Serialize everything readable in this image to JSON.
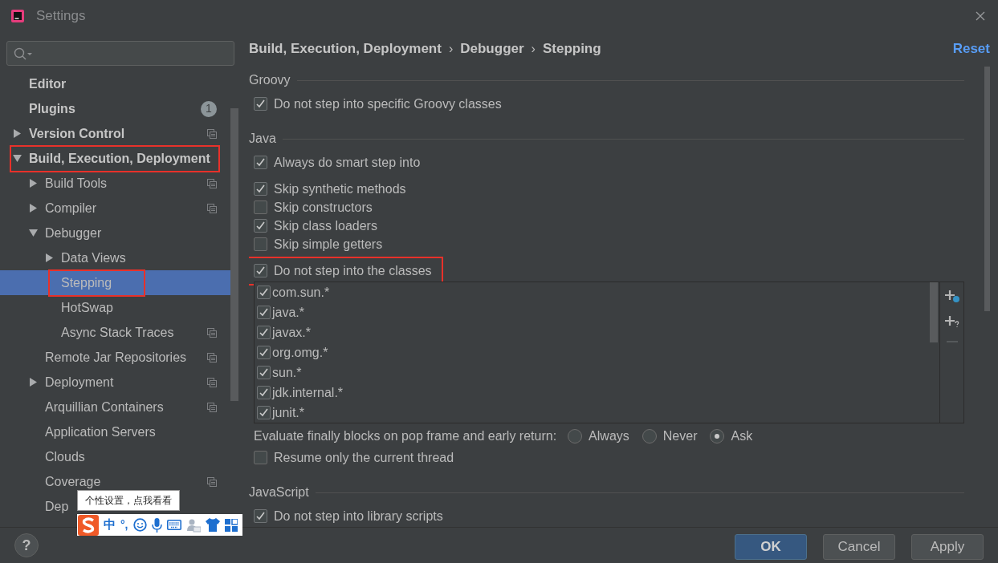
{
  "window": {
    "title": "Settings"
  },
  "sidebar": {
    "items": [
      {
        "label": "Editor",
        "selected": false
      },
      {
        "label": "Plugins",
        "selected": false,
        "badge": "1"
      },
      {
        "label": "Version Control",
        "selected": false,
        "expanded": false,
        "scoped": true
      },
      {
        "label": "Build, Execution, Deployment",
        "selected": false,
        "expanded": true,
        "highlighted": true,
        "children": [
          {
            "label": "Build Tools",
            "selected": false,
            "expanded": false,
            "scoped": true
          },
          {
            "label": "Compiler",
            "selected": false,
            "expanded": false,
            "scoped": true
          },
          {
            "label": "Debugger",
            "selected": false,
            "expanded": true,
            "children": [
              {
                "label": "Data Views",
                "selected": false,
                "expanded": false
              },
              {
                "label": "Stepping",
                "selected": true,
                "highlighted": true
              },
              {
                "label": "HotSwap",
                "selected": false
              },
              {
                "label": "Async Stack Traces",
                "selected": false,
                "scoped": true
              }
            ]
          },
          {
            "label": "Remote Jar Repositories",
            "selected": false,
            "scoped": true
          },
          {
            "label": "Deployment",
            "selected": false,
            "expanded": false,
            "scoped": true
          },
          {
            "label": "Arquillian Containers",
            "selected": false,
            "scoped": true
          },
          {
            "label": "Application Servers",
            "selected": false
          },
          {
            "label": "Clouds",
            "selected": false
          },
          {
            "label": "Coverage",
            "selected": false,
            "scoped": true
          },
          {
            "label": "Dep",
            "selected": false
          }
        ]
      }
    ]
  },
  "breadcrumb": {
    "parts": [
      "Build, Execution, Deployment",
      "Debugger",
      "Stepping"
    ],
    "separator": "›"
  },
  "reset": "Reset",
  "sections": [
    {
      "title": "Groovy",
      "items": [
        {
          "kind": "checkbox",
          "label": "Do not step into specific Groovy classes",
          "checked": true
        }
      ]
    },
    {
      "title": "Java",
      "items": [
        {
          "kind": "checkbox",
          "label": "Always do smart step into",
          "checked": true
        },
        {
          "kind": "checkbox",
          "label": "Skip synthetic methods",
          "checked": true
        },
        {
          "kind": "checkbox",
          "label": "Skip constructors",
          "checked": false
        },
        {
          "kind": "checkbox",
          "label": "Skip class loaders",
          "checked": true
        },
        {
          "kind": "checkbox",
          "label": "Skip simple getters",
          "checked": false
        },
        {
          "kind": "checkbox",
          "label": "Do not step into the classes",
          "checked": true,
          "highlighted": true
        },
        {
          "kind": "class_list",
          "rows": [
            {
              "label": "com.sun.*",
              "checked": true
            },
            {
              "label": "java.*",
              "checked": true
            },
            {
              "label": "javax.*",
              "checked": true
            },
            {
              "label": "org.omg.*",
              "checked": true
            },
            {
              "label": "sun.*",
              "checked": true
            },
            {
              "label": "jdk.internal.*",
              "checked": true
            },
            {
              "label": "junit.*",
              "checked": true
            }
          ],
          "remove_disabled": true
        },
        {
          "kind": "radio_group",
          "label": "Evaluate finally blocks on pop frame and early return:",
          "options": [
            {
              "label": "Always",
              "selected": false
            },
            {
              "label": "Never",
              "selected": false
            },
            {
              "label": "Ask",
              "selected": true
            }
          ]
        },
        {
          "kind": "checkbox",
          "label": "Resume only the current thread",
          "checked": false
        }
      ]
    },
    {
      "title": "JavaScript",
      "items": [
        {
          "kind": "checkbox",
          "label": "Do not step into library scripts",
          "checked": true
        }
      ]
    }
  ],
  "buttons": [
    {
      "label": "OK",
      "primary": true
    },
    {
      "label": "Cancel",
      "primary": false
    },
    {
      "label": "Apply",
      "primary": false
    }
  ],
  "help": "?",
  "ime": {
    "tooltip": "个性设置，点我看看",
    "chinese": "中",
    "punctuation": "°,"
  }
}
